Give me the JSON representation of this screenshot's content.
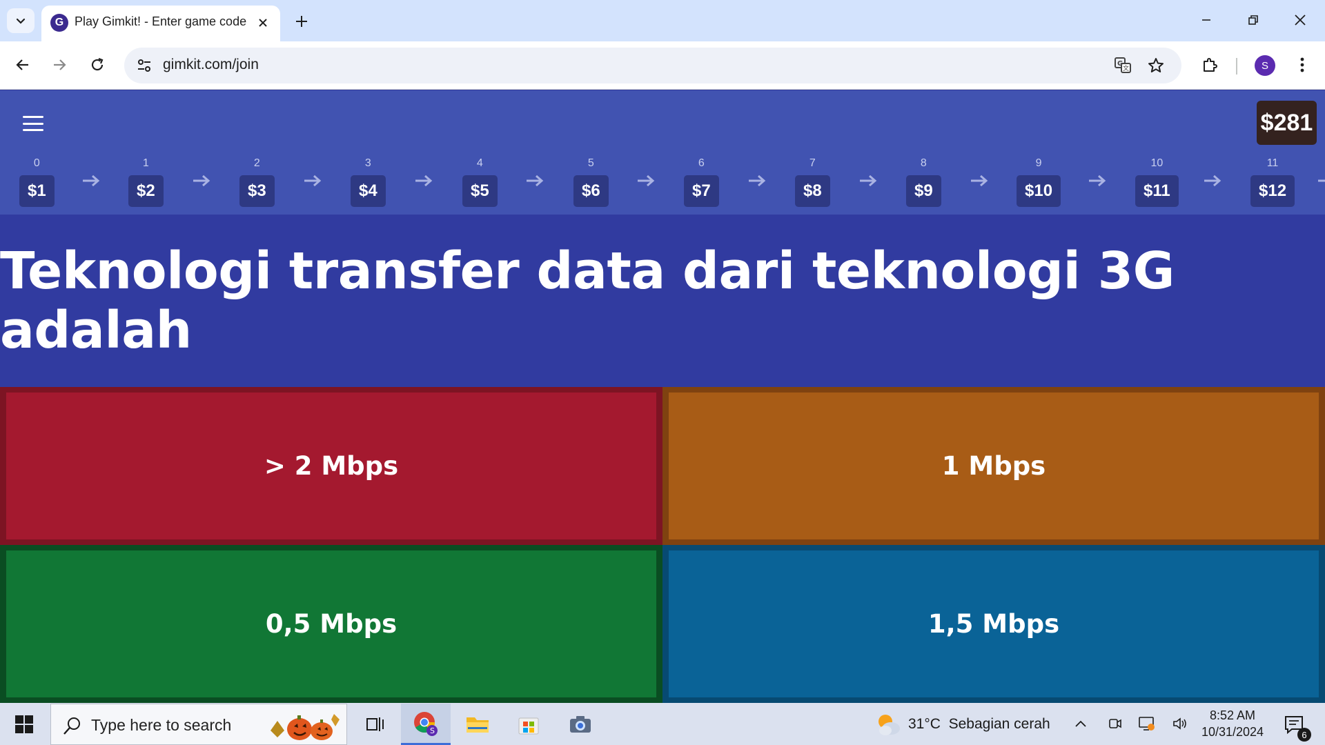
{
  "browser": {
    "tab_title": "Play Gimkit! - Enter game code",
    "favicon_letter": "G",
    "url": "gimkit.com/join",
    "profile_initial": "S"
  },
  "game": {
    "balance": "$281",
    "ladder": [
      {
        "index": "0",
        "value": "$1"
      },
      {
        "index": "1",
        "value": "$2"
      },
      {
        "index": "2",
        "value": "$3"
      },
      {
        "index": "3",
        "value": "$4"
      },
      {
        "index": "4",
        "value": "$5"
      },
      {
        "index": "5",
        "value": "$6"
      },
      {
        "index": "6",
        "value": "$7"
      },
      {
        "index": "7",
        "value": "$8"
      },
      {
        "index": "8",
        "value": "$9"
      },
      {
        "index": "9",
        "value": "$10"
      },
      {
        "index": "10",
        "value": "$11"
      },
      {
        "index": "11",
        "value": "$12"
      }
    ],
    "question": "Teknologi transfer data dari teknologi 3G adalah",
    "answers": [
      {
        "label": "> 2 Mbps",
        "color": "#a4192f",
        "border": "#7d1423"
      },
      {
        "label": "1 Mbps",
        "color": "#a85c16",
        "border": "#7f4210"
      },
      {
        "label": "0,5 Mbps",
        "color": "#117735",
        "border": "#0a4d22"
      },
      {
        "label": "1,5 Mbps",
        "color": "#0a6397",
        "border": "#074a72"
      }
    ]
  },
  "taskbar": {
    "search_placeholder": "Type here to search",
    "weather_temp": "31°C",
    "weather_desc": "Sebagian cerah",
    "time": "8:52 AM",
    "date": "10/31/2024",
    "notification_count": "6"
  }
}
